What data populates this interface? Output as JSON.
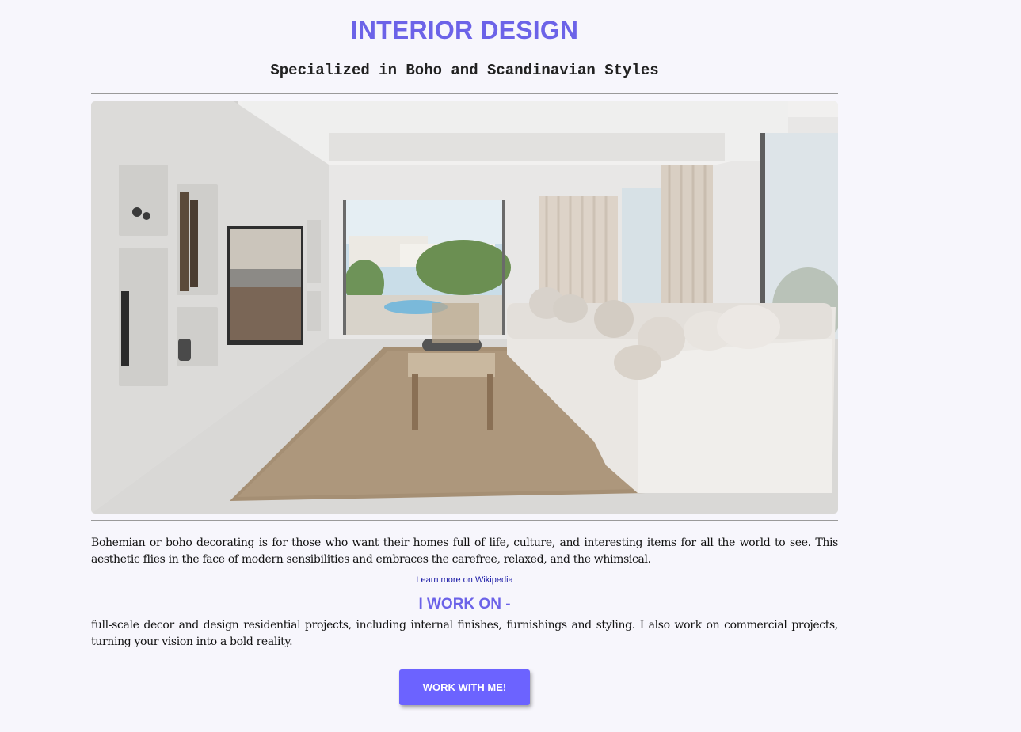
{
  "header": {
    "title": "INTERIOR DESIGN",
    "subtitle": "Specialized in Boho and Scandinavian Styles"
  },
  "hero": {
    "image_name": "boho-scandinavian-living-room-photo"
  },
  "intro": {
    "text": "Bohemian or boho decorating is for those who want their homes full of life, culture, and interesting items for all the world to see. This aesthetic flies in the face of modern sensibilities and embraces the carefree, relaxed, and the whimsical.",
    "link_label": "Learn more on Wikipedia"
  },
  "work": {
    "heading": "I WORK ON -",
    "text": "full-scale decor and design residential projects, including internal finishes, furnishings and styling. I also work on commercial projects, turning your vision into a bold reality.",
    "button_label": "WORK WITH ME!"
  },
  "colors": {
    "accent": "#6c63e8",
    "button": "#6c63ff",
    "background": "#f7f6fc",
    "link": "#1a1aa6"
  }
}
